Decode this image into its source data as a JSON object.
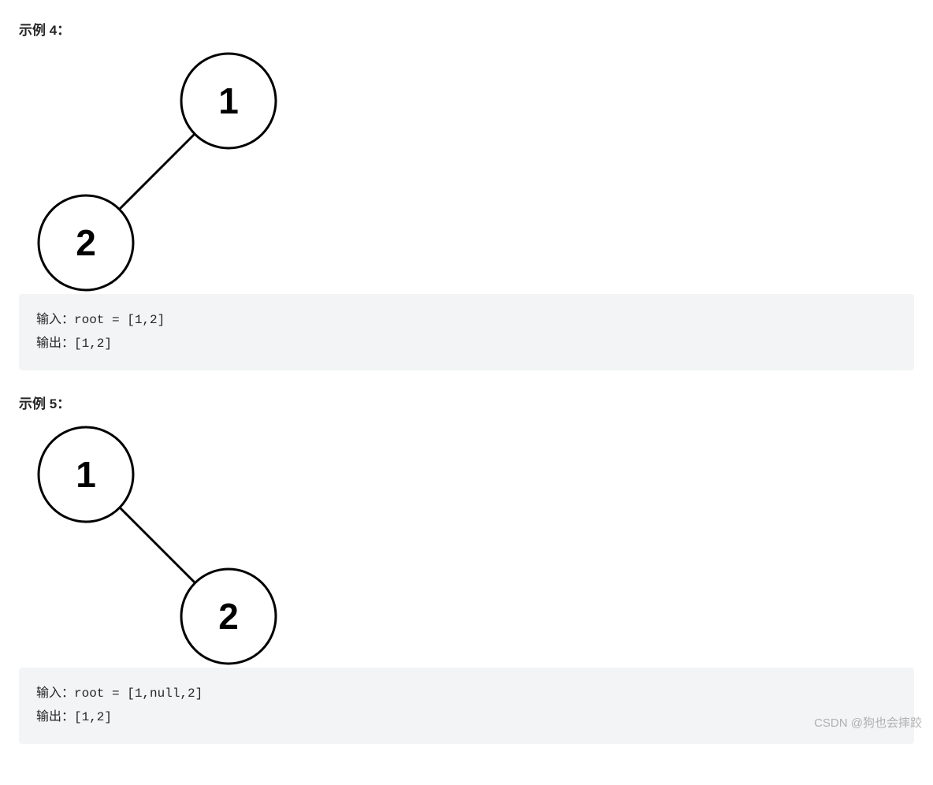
{
  "examples": [
    {
      "title": "示例 4：",
      "tree": {
        "type": "left-child",
        "nodes": [
          "1",
          "2"
        ]
      },
      "input_line": "输入：root = [1,2]",
      "output_line": "输出：[1,2]"
    },
    {
      "title": "示例 5：",
      "tree": {
        "type": "right-child",
        "nodes": [
          "1",
          "2"
        ]
      },
      "input_line": "输入：root = [1,null,2]",
      "output_line": "输出：[1,2]"
    }
  ],
  "watermark": "CSDN @狗也会摔跤"
}
